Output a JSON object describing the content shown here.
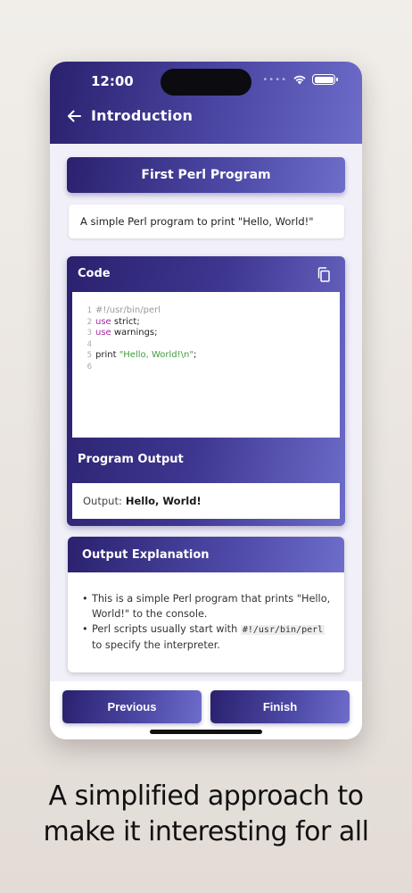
{
  "status_bar": {
    "time": "12:00"
  },
  "header": {
    "title": "Introduction"
  },
  "lesson": {
    "title": "First Perl Program",
    "description": "A simple Perl program to print \"Hello, World!\""
  },
  "code_card": {
    "heading": "Code",
    "lines": [
      {
        "num": "1",
        "parts": [
          {
            "text": "#!/usr/bin/perl",
            "style": "comment"
          }
        ]
      },
      {
        "num": "2",
        "parts": [
          {
            "text": "use",
            "style": "keyword"
          },
          {
            "text": " strict;",
            "style": "plain"
          }
        ]
      },
      {
        "num": "3",
        "parts": [
          {
            "text": "use",
            "style": "keyword"
          },
          {
            "text": " warnings;",
            "style": "plain"
          }
        ]
      },
      {
        "num": "4",
        "parts": []
      },
      {
        "num": "5",
        "parts": [
          {
            "text": "print ",
            "style": "plain"
          },
          {
            "text": "\"Hello, World!\\n\"",
            "style": "string"
          },
          {
            "text": ";",
            "style": "plain"
          }
        ]
      },
      {
        "num": "6",
        "parts": []
      }
    ],
    "output_heading": "Program Output",
    "output_label": "Output:",
    "output_value": "Hello, World!"
  },
  "explanation": {
    "heading": "Output Explanation",
    "bullet1": "This is a simple Perl program that prints \"Hello, World!\" to the console.",
    "bullet2_pre": "Perl scripts usually start with ",
    "bullet2_code": "#!/usr/bin/perl",
    "bullet2_post": " to specify the interpreter."
  },
  "footer": {
    "previous_label": "Previous",
    "finish_label": "Finish"
  },
  "caption": {
    "line1": "A simplified approach to",
    "line2": "make it interesting for all"
  }
}
